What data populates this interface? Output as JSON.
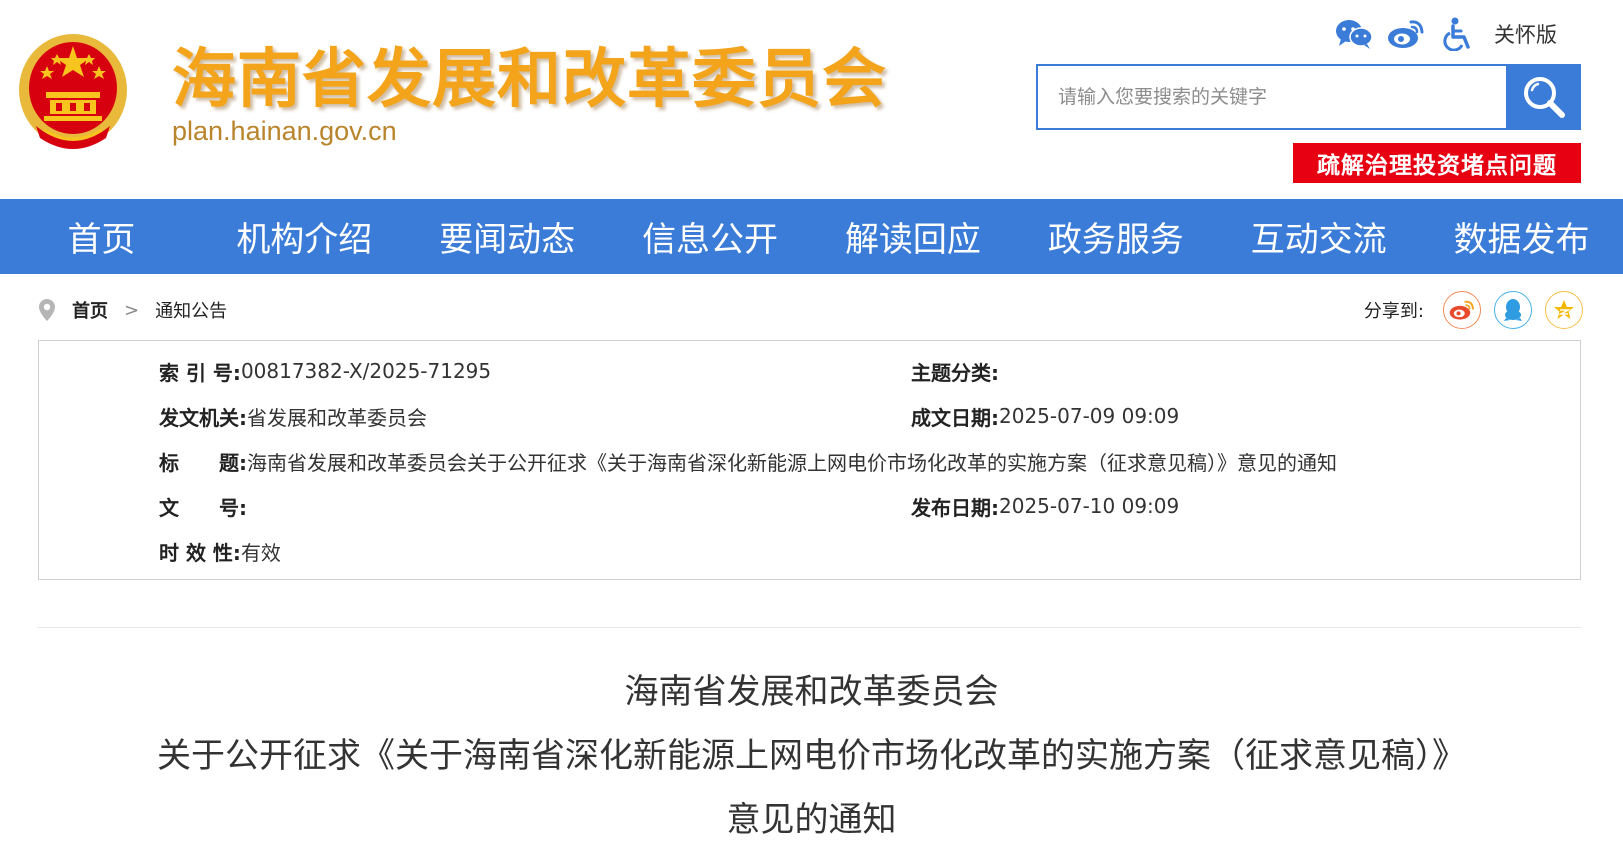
{
  "header": {
    "site_title": "海南省发展和改革委员会",
    "site_domain": "plan.hainan.gov.cn",
    "care_mode_label": "关怀版",
    "search_placeholder": "请输入您要搜索的关键字",
    "banner_label": "疏解治理投资堵点问题",
    "icons": [
      "wechat-icon",
      "weibo-icon",
      "accessibility-icon",
      "search-icon"
    ],
    "colors": {
      "title": "#f3a41a",
      "brand_blue": "#3b7cd8",
      "banner_red": "#e60012"
    }
  },
  "nav": {
    "items": [
      "首页",
      "机构介绍",
      "要闻动态",
      "信息公开",
      "解读回应",
      "政务服务",
      "互动交流",
      "数据发布"
    ]
  },
  "breadcrumb": {
    "home": "首页",
    "separator": ">",
    "current": "通知公告"
  },
  "share": {
    "label": "分享到:",
    "targets": [
      "weibo-share-icon",
      "qq-share-icon",
      "qzone-share-icon"
    ]
  },
  "info": {
    "index_label": "索 引 号:",
    "index_value": "00817382-X/2025-71295",
    "topic_label": "主题分类:",
    "topic_value": "",
    "issuer_label": "发文机关:",
    "issuer_value": "省发展和改革委员会",
    "written_date_label": "成文日期:",
    "written_date_value": "2025-07-09 09:09",
    "title_label": "标　　题:",
    "title_value": "海南省发展和改革委员会关于公开征求《关于海南省深化新能源上网电价市场化改革的实施方案（征求意见稿）》意见的通知",
    "docno_label": "文　　号:",
    "docno_value": "",
    "publish_date_label": "发布日期:",
    "publish_date_value": "2025-07-10 09:09",
    "validity_label": "时 效 性:",
    "validity_value": "有效"
  },
  "document": {
    "title_line1": "海南省发展和改革委员会",
    "title_line2": "关于公开征求《关于海南省深化新能源上网电价市场化改革的实施方案（征求意见稿）》",
    "title_line3": "意见的通知"
  }
}
